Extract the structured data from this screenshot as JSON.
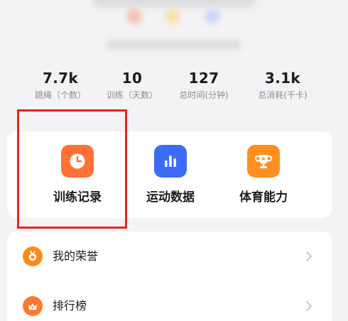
{
  "header": {
    "blurred": true,
    "dot_colors": [
      "#f3c3b5",
      "#f6e3a8",
      "#c9d8f3"
    ]
  },
  "stats": [
    {
      "value": "7.7k",
      "label": "跳绳（个数）"
    },
    {
      "value": "10",
      "label": "训练（天数）"
    },
    {
      "value": "127",
      "label": "总时间(分钟)"
    },
    {
      "value": "3.1k",
      "label": "总消耗(千卡)"
    }
  ],
  "features": [
    {
      "label": "训练记录",
      "icon": "clock-icon",
      "color": "#ff7235"
    },
    {
      "label": "运动数据",
      "icon": "bar-chart-icon",
      "color": "#3b6cf6"
    },
    {
      "label": "体育能力",
      "icon": "trophy-icon",
      "color": "#ff8f1f"
    }
  ],
  "menu": [
    {
      "label": "我的荣誉",
      "icon": "medal-icon",
      "color": "#ff8a1c"
    },
    {
      "label": "排行榜",
      "icon": "crown-icon",
      "color": "#ff7a2e"
    }
  ],
  "annotation": {
    "color": "#e8241c",
    "target": "训练记录"
  }
}
